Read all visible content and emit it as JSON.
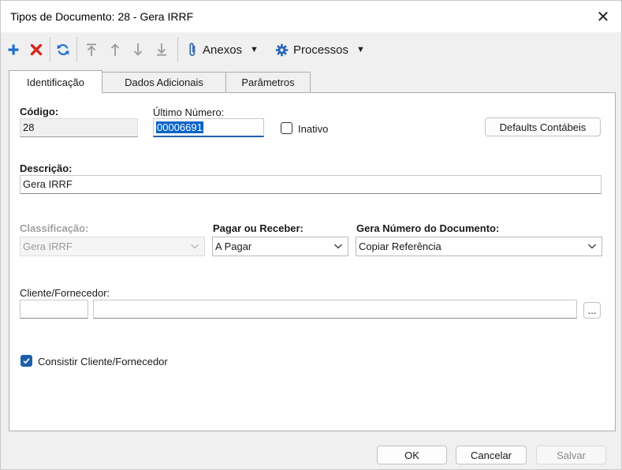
{
  "window": {
    "title": "Tipos de Documento: 28 - Gera IRRF",
    "close_label": "✕"
  },
  "toolbar": {
    "anexos_label": "Anexos",
    "processos_label": "Processos",
    "icons": [
      "plus-icon",
      "delete-x-icon",
      "refresh-icon",
      "move-top-icon",
      "move-up-icon",
      "move-down-icon",
      "move-bottom-icon",
      "paperclip-icon",
      "gear-icon"
    ]
  },
  "tabs": [
    {
      "label": "Identificação",
      "active": true
    },
    {
      "label": "Dados Adicionais",
      "active": false
    },
    {
      "label": "Parâmetros",
      "active": false
    }
  ],
  "form": {
    "codigo": {
      "label": "Código:",
      "value": "28"
    },
    "ultimo_numero": {
      "label": "Último Número:",
      "value": "00006691"
    },
    "inativo": {
      "label": "Inativo",
      "checked": false
    },
    "defaults_contabeis_label": "Defaults Contábeis",
    "descricao": {
      "label": "Descrição:",
      "value": "Gera IRRF"
    },
    "classificacao": {
      "label": "Classificação:",
      "value": "Gera IRRF"
    },
    "pagar_receber": {
      "label": "Pagar ou Receber:",
      "value": "A Pagar"
    },
    "gera_numero": {
      "label": "Gera Número do Documento:",
      "value": "Copiar Referência"
    },
    "cliente_fornecedor": {
      "label": "Cliente/Fornecedor:",
      "code": "",
      "name": "",
      "lookup_label": "..."
    },
    "consistir": {
      "label": "Consistir Cliente/Fornecedor",
      "checked": true
    }
  },
  "footer": {
    "ok_label": "OK",
    "cancelar_label": "Cancelar",
    "salvar_label": "Salvar"
  },
  "colors": {
    "accent": "#1f5fa8",
    "add_icon": "#1d6fd0",
    "delete_icon": "#d42a1e",
    "refresh_icon": "#1d6fd0",
    "arrow_icon_disabled": "#9a9a9a"
  }
}
